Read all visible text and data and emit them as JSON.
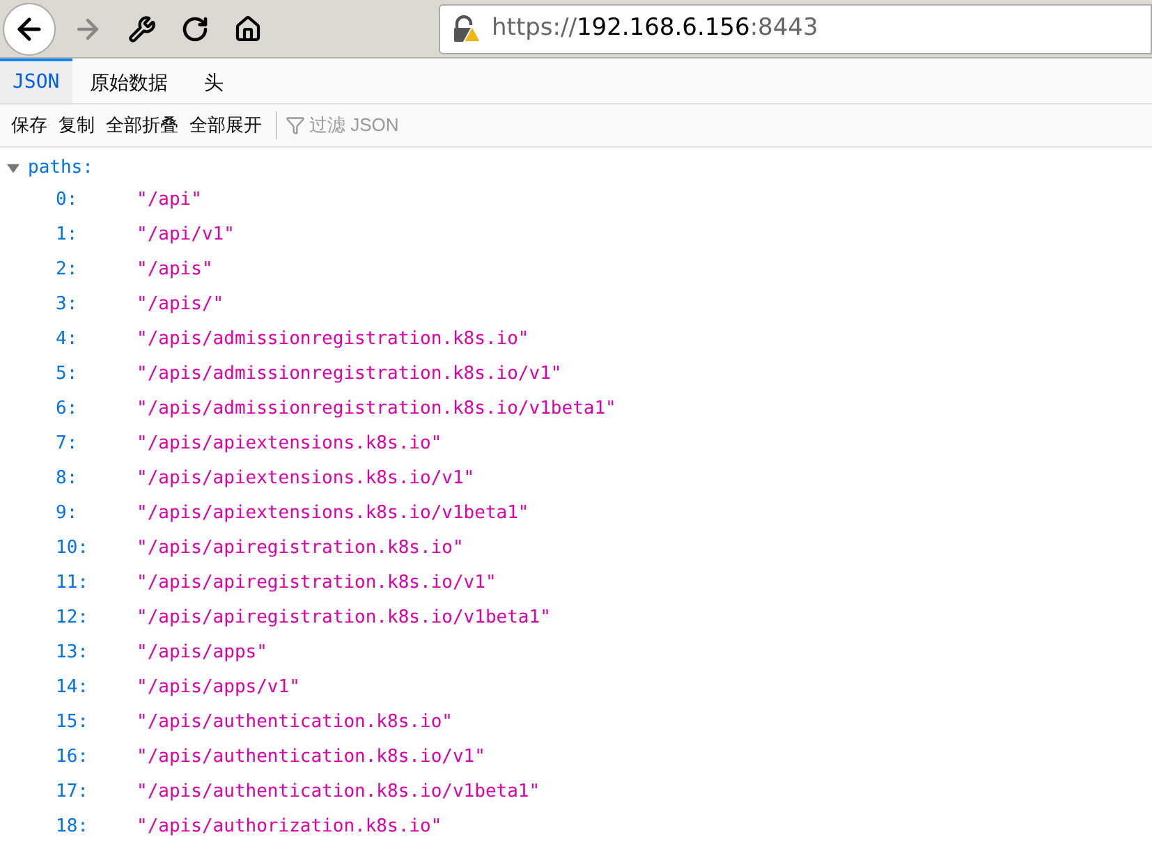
{
  "address_bar": {
    "scheme": "https://",
    "host": "192.168.6.156",
    "port": ":8443"
  },
  "tabs": [
    {
      "label": "JSON",
      "selected": true
    },
    {
      "label": "原始数据",
      "selected": false
    },
    {
      "label": "头",
      "selected": false
    }
  ],
  "toolbar": {
    "buttons": [
      "保存",
      "复制",
      "全部折叠",
      "全部展开"
    ],
    "filter_placeholder": "过滤 JSON"
  },
  "tree": {
    "key": "paths:",
    "expanded": true,
    "items": [
      {
        "index": "0:",
        "value": "\"/api\""
      },
      {
        "index": "1:",
        "value": "\"/api/v1\""
      },
      {
        "index": "2:",
        "value": "\"/apis\""
      },
      {
        "index": "3:",
        "value": "\"/apis/\""
      },
      {
        "index": "4:",
        "value": "\"/apis/admissionregistration.k8s.io\""
      },
      {
        "index": "5:",
        "value": "\"/apis/admissionregistration.k8s.io/v1\""
      },
      {
        "index": "6:",
        "value": "\"/apis/admissionregistration.k8s.io/v1beta1\""
      },
      {
        "index": "7:",
        "value": "\"/apis/apiextensions.k8s.io\""
      },
      {
        "index": "8:",
        "value": "\"/apis/apiextensions.k8s.io/v1\""
      },
      {
        "index": "9:",
        "value": "\"/apis/apiextensions.k8s.io/v1beta1\""
      },
      {
        "index": "10:",
        "value": "\"/apis/apiregistration.k8s.io\""
      },
      {
        "index": "11:",
        "value": "\"/apis/apiregistration.k8s.io/v1\""
      },
      {
        "index": "12:",
        "value": "\"/apis/apiregistration.k8s.io/v1beta1\""
      },
      {
        "index": "13:",
        "value": "\"/apis/apps\""
      },
      {
        "index": "14:",
        "value": "\"/apis/apps/v1\""
      },
      {
        "index": "15:",
        "value": "\"/apis/authentication.k8s.io\""
      },
      {
        "index": "16:",
        "value": "\"/apis/authentication.k8s.io/v1\""
      },
      {
        "index": "17:",
        "value": "\"/apis/authentication.k8s.io/v1beta1\""
      },
      {
        "index": "18:",
        "value": "\"/apis/authorization.k8s.io\""
      }
    ]
  }
}
